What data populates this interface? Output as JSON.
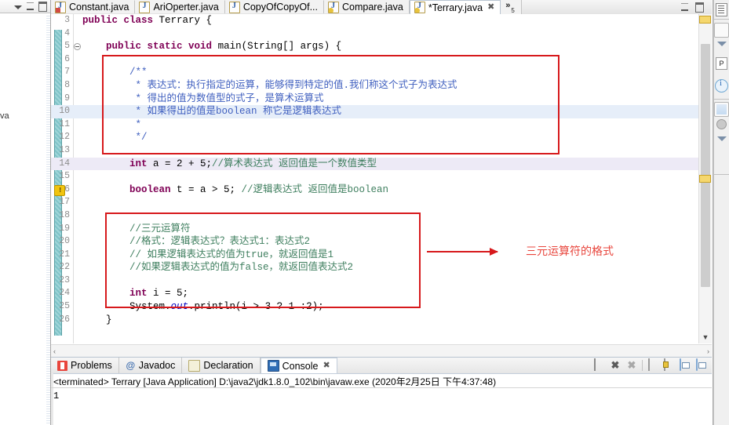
{
  "window": {
    "left_panel_truncated_label": "va"
  },
  "editor": {
    "tabs": [
      {
        "label": "Constant.java",
        "icon": "java-file-error-icon",
        "active": false,
        "closable": false
      },
      {
        "label": "AriOperter.java",
        "icon": "java-file-icon",
        "active": false,
        "closable": false
      },
      {
        "label": "CopyOfCopyOf...",
        "icon": "java-file-icon",
        "active": false,
        "closable": false
      },
      {
        "label": "Compare.java",
        "icon": "java-file-warning-icon",
        "active": false,
        "closable": false
      },
      {
        "label": "*Terrary.java",
        "icon": "java-file-warning-icon",
        "active": true,
        "closable": true,
        "close_glyph": "✖"
      }
    ],
    "overflow": {
      "chevron": "»",
      "count": "5"
    },
    "window_buttons": {
      "minimize": "minimize-icon",
      "maximize": "maximize-icon"
    },
    "code_lines": [
      {
        "num": "3",
        "segments": [
          {
            "t": "public ",
            "c": "kw"
          },
          {
            "t": "class ",
            "c": "kw"
          },
          {
            "t": "Terrary {",
            "c": "plain"
          }
        ]
      },
      {
        "num": "4",
        "segments": []
      },
      {
        "num": "5",
        "fold": true,
        "segments": [
          {
            "t": "    ",
            "c": "plain"
          },
          {
            "t": "public ",
            "c": "kw"
          },
          {
            "t": "static ",
            "c": "kw"
          },
          {
            "t": "void ",
            "c": "kw"
          },
          {
            "t": "main(String[] args) {",
            "c": "plain"
          }
        ]
      },
      {
        "num": "6",
        "segments": []
      },
      {
        "num": "7",
        "segments": [
          {
            "t": "        /**",
            "c": "cmt"
          }
        ]
      },
      {
        "num": "8",
        "segments": [
          {
            "t": "         * 表达式：执行指定的运算，能够得到特定的值.我们称这个式子为表达式",
            "c": "cmt"
          }
        ]
      },
      {
        "num": "9",
        "segments": [
          {
            "t": "         * 得出的值为数值型的式子，是算术运算式",
            "c": "cmt"
          }
        ]
      },
      {
        "num": "10",
        "highlight_row": true,
        "segments": [
          {
            "t": "         * 如果得出的值是",
            "c": "cmt"
          },
          {
            "t": "boolean",
            "c": "cn"
          },
          {
            "t": " 称它是逻辑表达式",
            "c": "cmt"
          }
        ]
      },
      {
        "num": "11",
        "segments": [
          {
            "t": "         *",
            "c": "cmt"
          }
        ]
      },
      {
        "num": "12",
        "segments": [
          {
            "t": "         */",
            "c": "cmt"
          }
        ]
      },
      {
        "num": "13",
        "segments": []
      },
      {
        "num": "14",
        "highlight": true,
        "segments": [
          {
            "t": "        ",
            "c": "plain"
          },
          {
            "t": "int ",
            "c": "kw"
          },
          {
            "t": "a = 2 + 5;",
            "c": "plain"
          },
          {
            "t": "//算术表达式 返回值是一个数值类型",
            "c": "cmt-line"
          }
        ]
      },
      {
        "num": "15",
        "segments": []
      },
      {
        "num": "16",
        "warn": true,
        "segments": [
          {
            "t": "        ",
            "c": "plain"
          },
          {
            "t": "boolean ",
            "c": "kw"
          },
          {
            "t": "t = a > 5; ",
            "c": "plain"
          },
          {
            "t": "//逻辑表达式 返回值是boolean",
            "c": "cmt-line"
          }
        ]
      },
      {
        "num": "17",
        "segments": []
      },
      {
        "num": "18",
        "segments": []
      },
      {
        "num": "19",
        "segments": [
          {
            "t": "        //三元运算符",
            "c": "cmt-line"
          }
        ]
      },
      {
        "num": "20",
        "segments": [
          {
            "t": "        //格式：逻辑表达式？表达式1：表达式2",
            "c": "cmt-line"
          }
        ]
      },
      {
        "num": "21",
        "segments": [
          {
            "t": "        // 如果逻辑表达式的值为true，就返回值是1",
            "c": "cmt-line"
          }
        ]
      },
      {
        "num": "22",
        "segments": [
          {
            "t": "        //如果逻辑表达式的值为false，就返回值表达式2",
            "c": "cmt-line"
          }
        ]
      },
      {
        "num": "23",
        "segments": []
      },
      {
        "num": "24",
        "segments": [
          {
            "t": "        ",
            "c": "plain"
          },
          {
            "t": "int ",
            "c": "kw"
          },
          {
            "t": "i = 5;",
            "c": "plain"
          }
        ]
      },
      {
        "num": "25",
        "segments": [
          {
            "t": "        System.",
            "c": "plain"
          },
          {
            "t": "out",
            "c": "field"
          },
          {
            "t": ".println(i > 3 ? 1 :2);",
            "c": "plain"
          }
        ]
      },
      {
        "num": "26",
        "segments": [
          {
            "t": "    }",
            "c": "plain"
          }
        ]
      }
    ],
    "annotations": {
      "ternary_label": "三元运算符的格式",
      "box_color": "#d7191c",
      "label_color": "#e8453c"
    },
    "hscroll": {
      "left_arrow": "‹",
      "right_arrow": "›"
    },
    "vscroll": {
      "up_arrow": "▲",
      "down_arrow": "▼"
    }
  },
  "bottom_panel": {
    "tabs": [
      {
        "label": "Problems",
        "icon": "problems-icon",
        "active": false
      },
      {
        "label": "Javadoc",
        "icon": "javadoc-icon",
        "active": false,
        "glyph": "@"
      },
      {
        "label": "Declaration",
        "icon": "declaration-icon",
        "active": false
      },
      {
        "label": "Console",
        "icon": "console-icon",
        "active": true,
        "close_glyph": "✖"
      }
    ],
    "toolbar": [
      {
        "name": "terminate-button",
        "glyph": ""
      },
      {
        "name": "remove-launch-button",
        "glyph": "✖"
      },
      {
        "name": "remove-all-terminated-button",
        "glyph": "✖"
      },
      {
        "name": "clear-console-button",
        "glyph": ""
      },
      {
        "name": "scroll-lock-button",
        "glyph": ""
      },
      {
        "name": "display-selected-console-button",
        "glyph": ""
      },
      {
        "name": "open-console-button",
        "glyph": ""
      }
    ],
    "console": {
      "status": "<terminated> Terrary [Java Application] D:\\java2\\jdk1.8.0_102\\bin\\javaw.exe (2020年2月25日 下午4:37:48)",
      "output": "1"
    }
  },
  "right_toolbar": {
    "items": [
      {
        "name": "outline-view-icon"
      },
      {
        "name": "package-explorer-icon"
      },
      {
        "name": "minimize-view-icon"
      },
      {
        "name": "problems-label",
        "label": "P"
      },
      {
        "name": "javadoc-info-icon"
      },
      {
        "name": "hierarchy-icon"
      },
      {
        "name": "members-icon"
      },
      {
        "name": "restore-icon"
      }
    ]
  }
}
